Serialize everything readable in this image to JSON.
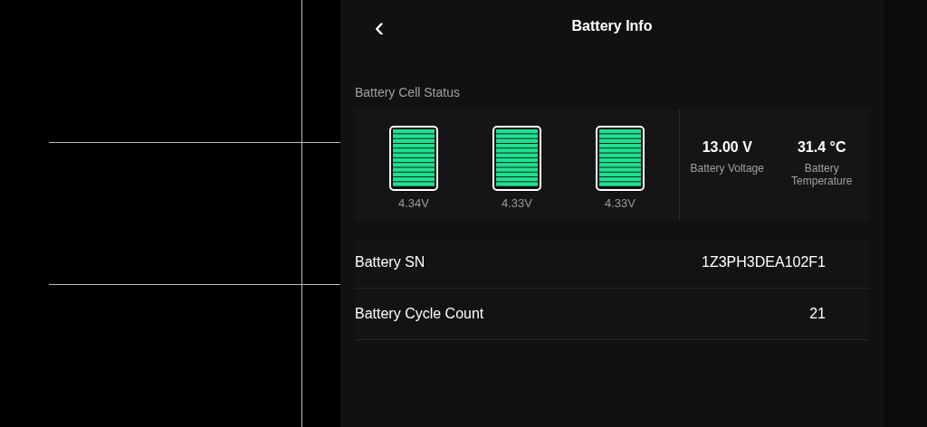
{
  "header": {
    "back_icon": "‹",
    "title": "Battery Info"
  },
  "cell_status": {
    "title": "Battery Cell Status",
    "cells": [
      {
        "reading": "4.34V"
      },
      {
        "reading": "4.33V"
      },
      {
        "reading": "4.33V"
      }
    ],
    "stats": [
      {
        "value": "13.00 V",
        "label": "Battery Voltage"
      },
      {
        "value": "31.4 °C",
        "label": "Battery Temperature"
      }
    ]
  },
  "rows": [
    {
      "label": "Battery SN",
      "value": "1Z3PH3DEA102F1"
    },
    {
      "label": "Battery Cycle Count",
      "value": "21"
    }
  ]
}
